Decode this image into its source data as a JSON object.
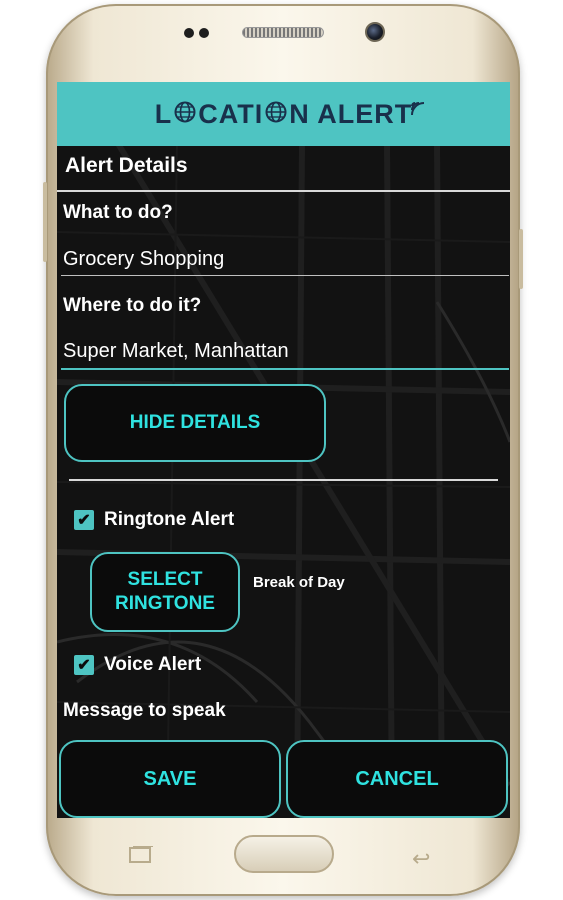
{
  "app": {
    "logo_text_part1": "L",
    "logo_text_part2": "CATI",
    "logo_text_part3": "N ALERT",
    "brand_color": "#4ec4c2",
    "accent_text_color": "#2fe2e0"
  },
  "alert_details": {
    "title": "Alert Details",
    "what_label": "What to do?",
    "what_value": "Grocery Shopping",
    "where_label": "Where to do it?",
    "where_value": "Super Market, Manhattan",
    "hide_details_button": "HIDE DETAILS"
  },
  "ringtone": {
    "checkbox_label": "Ringtone Alert",
    "checked": true,
    "select_button_line1": "SELECT",
    "select_button_line2": "RINGTONE",
    "selected_ringtone": "Break of Day"
  },
  "voice": {
    "checkbox_label": "Voice Alert",
    "checked": true,
    "message_label": "Message to speak"
  },
  "footer": {
    "save_button": "SAVE",
    "cancel_button": "CANCEL"
  },
  "icons": {
    "check": "✔",
    "back": "↩"
  }
}
